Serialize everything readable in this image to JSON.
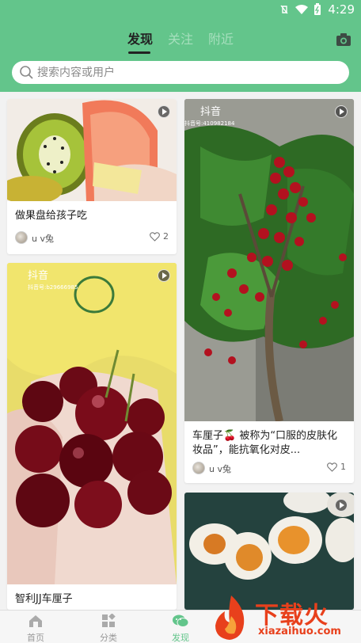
{
  "status_bar": {
    "time": "4:29"
  },
  "tabs": [
    {
      "label": "发现",
      "active": true
    },
    {
      "label": "关注",
      "active": false
    },
    {
      "label": "附近",
      "active": false
    }
  ],
  "search": {
    "placeholder": "搜索内容或用户"
  },
  "feed": {
    "left": [
      {
        "title": "做果盘给孩子吃",
        "author": "u v兔",
        "likes": "2"
      },
      {
        "title": "智利JJ车厘子",
        "author": "",
        "likes": ""
      }
    ],
    "right": [
      {
        "title": "车厘子🍒 被称为“口服的皮肤化妆品”，能抗氧化对皮...",
        "author": "u v兔",
        "likes": "1",
        "watermark_text": "抖音",
        "watermark_id": "抖音号:410982184"
      },
      {
        "title": "",
        "author": "",
        "likes": ""
      }
    ],
    "left_watermark": {
      "text": "抖音",
      "id": "抖音号:b29666985"
    }
  },
  "bottom_nav": [
    {
      "label": "首页",
      "icon": "home-icon",
      "active": false
    },
    {
      "label": "分类",
      "icon": "grid-icon",
      "active": false
    },
    {
      "label": "发现",
      "icon": "discover-icon",
      "active": true
    }
  ],
  "watermark": {
    "title": "下载火",
    "subtitle": "xiazaihuo.com"
  },
  "colors": {
    "primary": "#63c58b",
    "accent": "#e8401c"
  }
}
